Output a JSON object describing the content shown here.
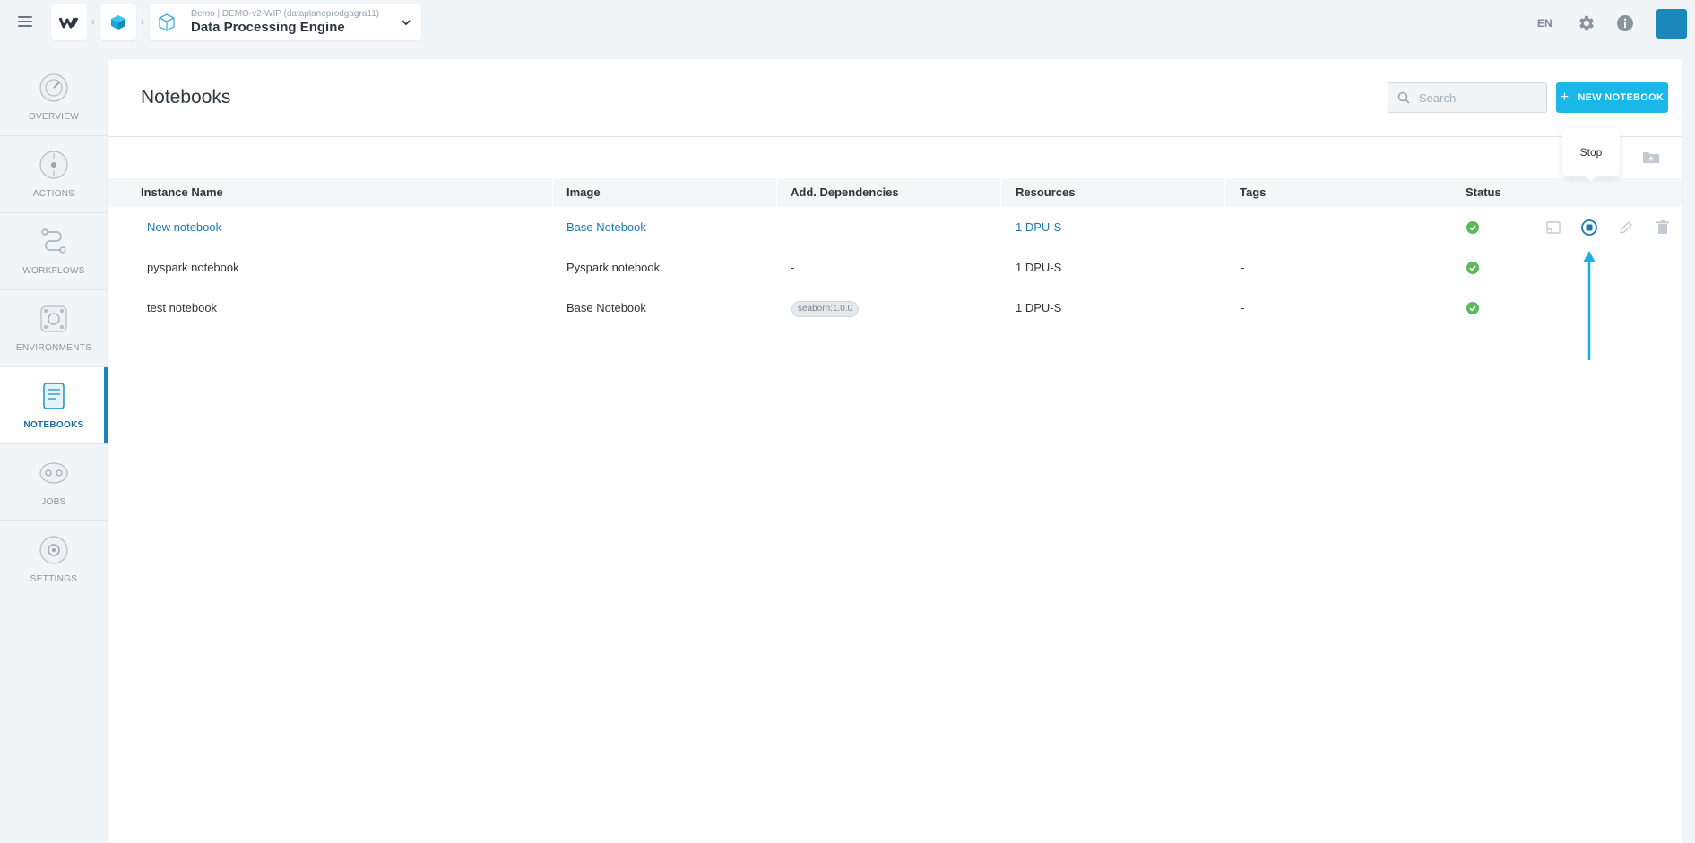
{
  "header": {
    "breadcrumb_sub": "Demo | DEMO-v2-WIP (dataplaneprodgagra11)",
    "breadcrumb_title": "Data Processing Engine",
    "language": "EN"
  },
  "sidebar": {
    "items": [
      {
        "label": "OVERVIEW",
        "icon": "overview-icon",
        "active": false
      },
      {
        "label": "ACTIONS",
        "icon": "actions-icon",
        "active": false
      },
      {
        "label": "WORKFLOWS",
        "icon": "workflows-icon",
        "active": false
      },
      {
        "label": "ENVIRONMENTS",
        "icon": "environments-icon",
        "active": false
      },
      {
        "label": "NOTEBOOKS",
        "icon": "notebooks-icon",
        "active": true
      },
      {
        "label": "JOBS",
        "icon": "jobs-icon",
        "active": false
      },
      {
        "label": "SETTINGS",
        "icon": "settings-icon",
        "active": false
      }
    ]
  },
  "main": {
    "title": "Notebooks",
    "search_placeholder": "Search",
    "new_button_label": "NEW NOTEBOOK",
    "tooltip": "Stop",
    "columns": [
      "Instance Name",
      "Image",
      "Add. Dependencies",
      "Resources",
      "Tags",
      "Status"
    ],
    "rows": [
      {
        "name": "New notebook",
        "image": "Base Notebook",
        "deps": "-",
        "resources": "1 DPU-S",
        "tags": "-",
        "status": "running",
        "link": true
      },
      {
        "name": "pyspark notebook",
        "image": "Pyspark notebook",
        "deps": "-",
        "resources": "1 DPU-S",
        "tags": "-",
        "status": "running",
        "link": false
      },
      {
        "name": "test notebook",
        "image": "Base Notebook",
        "deps": "seaborn:1.0.0",
        "resources": "1 DPU-S",
        "tags": "-",
        "status": "running",
        "link": false
      }
    ]
  },
  "colors": {
    "accent": "#1ab8e8",
    "brand": "#1a88b8",
    "link": "#1a7bb0",
    "status_ok": "#5cb85c"
  }
}
